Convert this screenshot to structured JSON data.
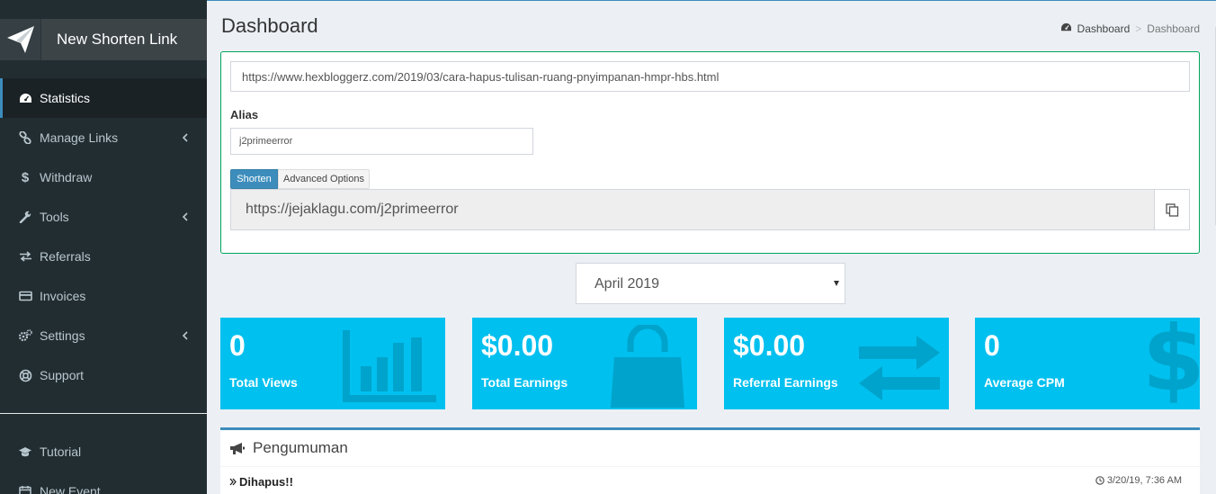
{
  "brand": {
    "button_label": "New Shorten Link"
  },
  "menu": [
    {
      "label": "Statistics",
      "icon": "dashboard-icon",
      "active": true,
      "has_chevron": false
    },
    {
      "label": "Manage Links",
      "icon": "link-icon",
      "active": false,
      "has_chevron": true
    },
    {
      "label": "Withdraw",
      "icon": "dollar-icon",
      "active": false,
      "has_chevron": false
    },
    {
      "label": "Tools",
      "icon": "wrench-icon",
      "active": false,
      "has_chevron": true
    },
    {
      "label": "Referrals",
      "icon": "exchange-icon",
      "active": false,
      "has_chevron": false
    },
    {
      "label": "Invoices",
      "icon": "credit-card-icon",
      "active": false,
      "has_chevron": false
    },
    {
      "label": "Settings",
      "icon": "cogs-icon",
      "active": false,
      "has_chevron": true
    },
    {
      "label": "Support",
      "icon": "life-ring-icon",
      "active": false,
      "has_chevron": false
    }
  ],
  "menu2": [
    {
      "label": "Tutorial",
      "icon": "graduation-cap-icon"
    },
    {
      "label": "New Event",
      "icon": "calendar-icon"
    }
  ],
  "header": {
    "title": "Dashboard",
    "breadcrumb": [
      "Dashboard",
      "Dashboard"
    ]
  },
  "shorten": {
    "url_value": "https://www.hexbloggerz.com/2019/03/cara-hapus-tulisan-ruang-pnyimpanan-hmpr-hbs.html",
    "alias_label": "Alias",
    "alias_value": "j2primeerror",
    "shorten_label": "Shorten",
    "advanced_label": "Advanced Options",
    "result_value": "https://jejaklagu.com/j2primeerror"
  },
  "month": {
    "selected": "April 2019"
  },
  "stats": [
    {
      "value": "0",
      "label": "Total Views",
      "icon": "bar-chart-icon"
    },
    {
      "value": "$0.00",
      "label": "Total Earnings",
      "icon": "shopping-bag-icon"
    },
    {
      "value": "$0.00",
      "label": "Referral Earnings",
      "icon": "exchange-icon"
    },
    {
      "value": "0",
      "label": "Average CPM",
      "icon": "dollar-icon"
    }
  ],
  "announcement": {
    "heading": "Pengumuman",
    "items": [
      {
        "title": "Dihapus!!",
        "time": "3/20/19, 7:36 AM"
      }
    ]
  },
  "colors": {
    "sidebar": "#222d32",
    "accent": "#3c8dbc",
    "stat_box": "#00c0ef",
    "success_border": "#00a65a"
  }
}
